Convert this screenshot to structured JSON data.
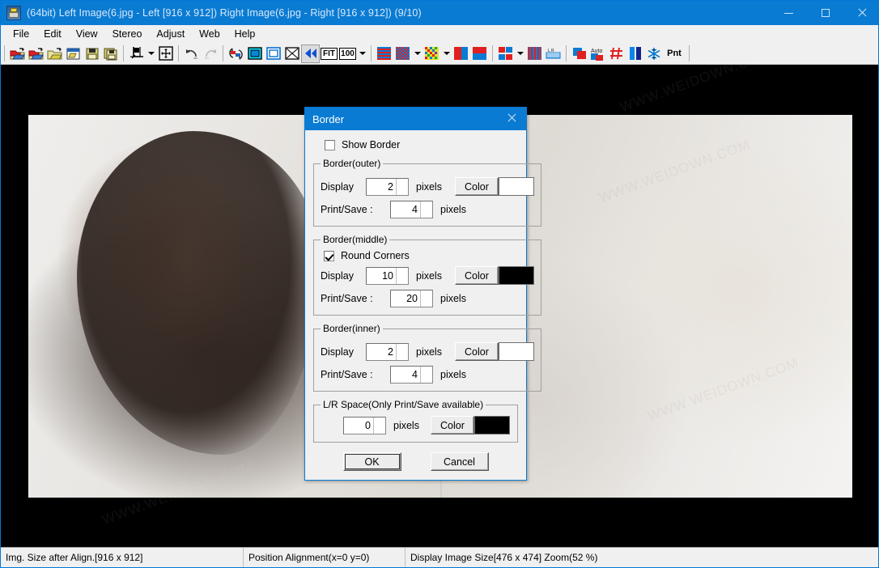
{
  "window": {
    "title": "(64bit) Left Image(6.jpg - Left [916 x 912]) Right Image(6.jpg - Right [916 x 912])  (9/10)",
    "icon": "stereo-photo-maker-icon",
    "minimize": "minimize-icon",
    "maximize": "maximize-icon",
    "close": "close-icon",
    "accent_color": "#0a7bd3"
  },
  "menu": {
    "items": [
      {
        "label": "File"
      },
      {
        "label": "Edit"
      },
      {
        "label": "View"
      },
      {
        "label": "Stereo"
      },
      {
        "label": "Adjust"
      },
      {
        "label": "Web"
      },
      {
        "label": "Help"
      }
    ]
  },
  "toolbar": {
    "buttons": [
      {
        "name": "open-left-image-icon",
        "title": "Open Left Image"
      },
      {
        "name": "open-right-image-icon",
        "title": "Open Right Image"
      },
      {
        "name": "open-stereo-image-icon",
        "title": "Open Stereo Image"
      },
      {
        "name": "open-multi-image-icon",
        "title": "Open Multi Image"
      },
      {
        "name": "save-icon",
        "title": "Save"
      },
      {
        "name": "save-as-icon",
        "title": "Save As"
      },
      {
        "name": "crop-icon",
        "title": "Crop"
      },
      {
        "name": "crop-dropdown-arrow-icon",
        "title": "Crop options"
      },
      {
        "name": "easy-adjustment-icon",
        "title": "Easy Adjustment"
      },
      {
        "name": "undo-icon",
        "title": "Undo"
      },
      {
        "name": "redo-icon",
        "title": "Redo"
      },
      {
        "name": "swap-left-right-icon",
        "title": "Swap Left/Right"
      },
      {
        "name": "view-stereo-card-icon",
        "title": "Stereo Card"
      },
      {
        "name": "view-window-icon",
        "title": "Window View"
      },
      {
        "name": "fit-diagonal-icon",
        "title": "Fit Diagonal"
      },
      {
        "name": "parallel-view-icon",
        "title": "Parallel View"
      },
      {
        "name": "zoom-fit-label",
        "title": "FIT",
        "text": "FIT"
      },
      {
        "name": "zoom-100-label",
        "title": "100%",
        "text": "100"
      },
      {
        "name": "zoom-dropdown-arrow-icon",
        "title": "Zoom options"
      },
      {
        "name": "interlaced-icon",
        "title": "Interlaced"
      },
      {
        "name": "checkerboard-icon",
        "title": "Checkerboard"
      },
      {
        "name": "checkerboard-dropdown-arrow-icon",
        "title": "Checkerboard options"
      },
      {
        "name": "color-mosaic-icon",
        "title": "Color Mosaic"
      },
      {
        "name": "color-mosaic-dropdown-arrow-icon",
        "title": "Color mosaic options"
      },
      {
        "name": "side-by-side-icon",
        "title": "Side by Side"
      },
      {
        "name": "over-under-icon",
        "title": "Over/Under"
      },
      {
        "name": "quad-view-icon",
        "title": "Quad View"
      },
      {
        "name": "quad-view-dropdown-arrow-icon",
        "title": "Quad view options"
      },
      {
        "name": "vertical-stripes-icon",
        "title": "Vertical Stripes"
      },
      {
        "name": "anaglyph-glasses-icon",
        "title": "Anaglyph Glasses"
      },
      {
        "name": "color-anaglyph-icon",
        "title": "Color Anaglyph"
      },
      {
        "name": "auto-alignment-icon",
        "title": "Auto Alignment",
        "text": "Auto"
      },
      {
        "name": "grid-overlay-icon",
        "title": "Grid Overlay"
      },
      {
        "name": "blue-bars-icon",
        "title": "Blue Bars"
      },
      {
        "name": "snowflake-icon",
        "title": "Snowflake"
      },
      {
        "name": "print-label",
        "title": "Print",
        "text": "Pnt"
      }
    ]
  },
  "dialog": {
    "title": "Border",
    "close_icon": "close-icon",
    "show_border": {
      "label": "Show Border",
      "checked": false
    },
    "groups": [
      {
        "legend": "Border(outer)",
        "round_corners": null,
        "display": {
          "label": "Display",
          "value": "2",
          "unit": "pixels"
        },
        "print_save": {
          "label": "Print/Save :",
          "value": "4",
          "unit": "pixels"
        },
        "color": {
          "label": "Color",
          "value": "#ffffff"
        }
      },
      {
        "legend": "Border(middle)",
        "round_corners": {
          "label": "Round Corners",
          "checked": true
        },
        "display": {
          "label": "Display",
          "value": "10",
          "unit": "pixels"
        },
        "print_save": {
          "label": "Print/Save :",
          "value": "20",
          "unit": "pixels"
        },
        "color": {
          "label": "Color",
          "value": "#000000"
        }
      },
      {
        "legend": "Border(inner)",
        "round_corners": null,
        "display": {
          "label": "Display",
          "value": "2",
          "unit": "pixels"
        },
        "print_save": {
          "label": "Print/Save :",
          "value": "4",
          "unit": "pixels"
        },
        "color": {
          "label": "Color",
          "value": "#ffffff"
        }
      }
    ],
    "lr_space": {
      "legend": "L/R Space(Only Print/Save available)",
      "value": "0",
      "unit": "pixels",
      "color": {
        "label": "Color",
        "value": "#000000"
      }
    },
    "ok_label": "OK",
    "cancel_label": "Cancel"
  },
  "statusbar": {
    "cells": [
      "Img. Size after Align.[916 x 912]",
      "Position Alignment(x=0 y=0)",
      "Display Image Size[476 x 474]  Zoom(52 %)"
    ]
  },
  "watermark": {
    "text": "WWW.WEIDOWN.COM"
  }
}
